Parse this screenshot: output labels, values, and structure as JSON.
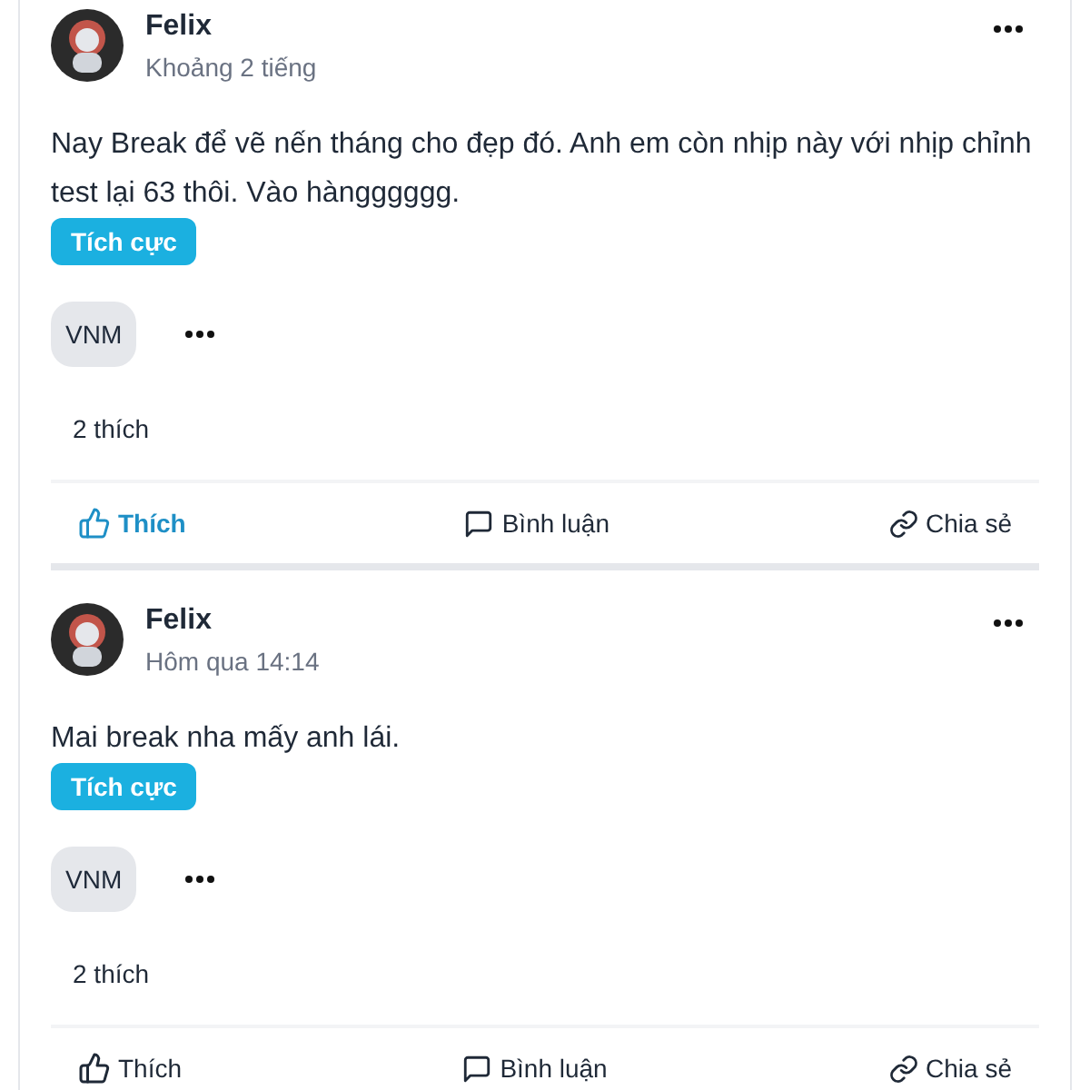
{
  "posts": [
    {
      "author": "Felix",
      "time": "Khoảng 2 tiếng",
      "text": "Nay Break để vẽ nến tháng cho đẹp đó. Anh em còn nhịp này với nhịp chỉnh test lại 63 thôi. Vào hàngggggg.",
      "tag": "Tích cực",
      "tickers": [
        "VNM"
      ],
      "likes": "2 thích",
      "actions": [
        {
          "kind": "like",
          "label": "Thích",
          "selected": true
        },
        {
          "kind": "comment",
          "label": "Bình luận",
          "selected": false
        },
        {
          "kind": "share",
          "label": "Chia sẻ",
          "selected": false
        }
      ]
    },
    {
      "author": "Felix",
      "time": "Hôm qua 14:14",
      "text": "Mai break nha mấy anh lái.",
      "tag": "Tích cực",
      "tickers": [
        "VNM"
      ],
      "likes": "2 thích",
      "actions": [
        {
          "kind": "like",
          "label": "Thích",
          "selected": false
        },
        {
          "kind": "comment",
          "label": "Bình luận",
          "selected": false
        },
        {
          "kind": "share",
          "label": "Chia sẻ",
          "selected": false
        }
      ]
    }
  ]
}
